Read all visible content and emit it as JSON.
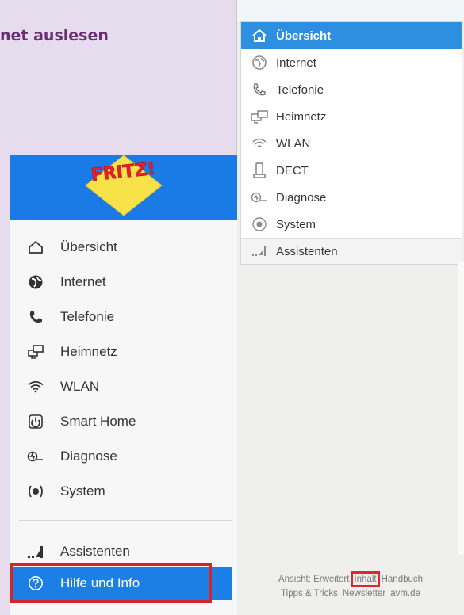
{
  "heading": "net auslesen",
  "old_menu": {
    "items": [
      {
        "label": "Übersicht",
        "icon": "home-icon",
        "active": true
      },
      {
        "label": "Internet",
        "icon": "globe-icon"
      },
      {
        "label": "Telefonie",
        "icon": "phone-icon"
      },
      {
        "label": "Heimnetz",
        "icon": "network-icon"
      },
      {
        "label": "WLAN",
        "icon": "wifi-icon"
      },
      {
        "label": "DECT",
        "icon": "dect-phone-icon"
      },
      {
        "label": "Diagnose",
        "icon": "diagnose-icon"
      },
      {
        "label": "System",
        "icon": "system-icon"
      }
    ],
    "assistants": "Assistenten"
  },
  "old_footer": {
    "row1": [
      "Ansicht: Erweitert",
      "Inhalt",
      "Handbuch"
    ],
    "row2": [
      "Tipps & Tricks",
      "Newsletter",
      "avm.de"
    ]
  },
  "new_menu": {
    "logo_text": "FRITZ!",
    "items": [
      {
        "label": "Übersicht",
        "icon": "home-icon"
      },
      {
        "label": "Internet",
        "icon": "globe-icon"
      },
      {
        "label": "Telefonie",
        "icon": "phone-icon"
      },
      {
        "label": "Heimnetz",
        "icon": "network-icon"
      },
      {
        "label": "WLAN",
        "icon": "wifi-icon"
      },
      {
        "label": "Smart Home",
        "icon": "smart-home-icon"
      },
      {
        "label": "Diagnose",
        "icon": "diagnose-icon"
      },
      {
        "label": "System",
        "icon": "system-icon"
      }
    ],
    "assistants": "Assistenten",
    "help": "Hilfe und Info"
  },
  "colors": {
    "background": "#e6dced",
    "heading": "#6b2e73",
    "active_blue": "#2e8ee0",
    "header_blue": "#1a7ae6",
    "highlight_red": "#d3232b"
  }
}
